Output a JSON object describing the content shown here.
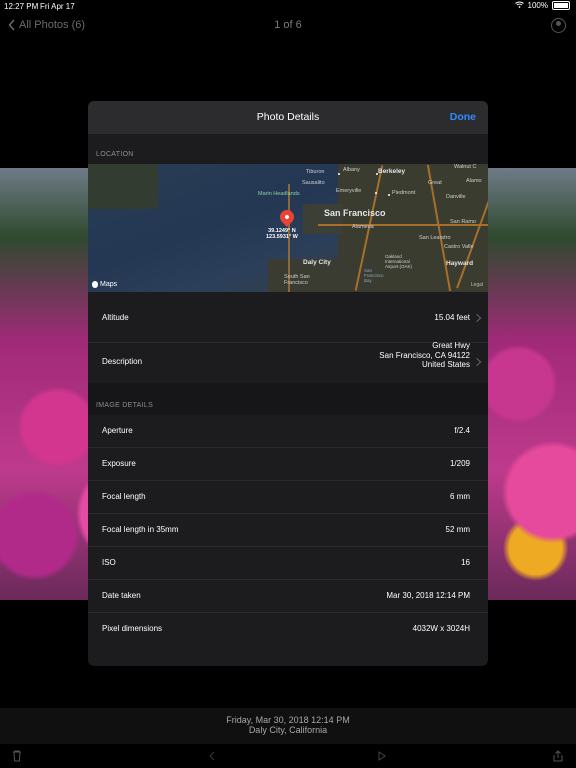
{
  "status_bar": {
    "time": "12:27 PM",
    "date": "Fri Apr 17",
    "battery": "100%"
  },
  "nav": {
    "back_label": "All Photos (6)",
    "title": "1 of 6"
  },
  "modal": {
    "title": "Photo Details",
    "done_label": "Done",
    "location_header": "LOCATION",
    "image_details_header": "IMAGE DETAILS"
  },
  "map": {
    "maps_brand": "Maps",
    "legal": "Legal",
    "coord_lat": "39.1249° N",
    "coord_lon": "123.5931° W",
    "labels": {
      "tiburon": "Tiburon",
      "albany": "Albany",
      "berkeley": "Berkeley",
      "walnut": "Walnut C",
      "sausalito": "Sausalito",
      "emeryville": "Emeryville",
      "piedmont": "Piedmont",
      "great": "Great",
      "alamo": "Alamo",
      "marin": "Marin Headlands",
      "danville": "Danville",
      "sf": "San Francisco",
      "alameda": "Alameda",
      "sanramon": "San Ramo",
      "sanleandro": "San Leandro",
      "castro": "Castro Valle",
      "oakland": "Oakland International Airport (OAK)",
      "daly": "Daly City",
      "hayward": "Hayward",
      "sfbay": "San Francisco Bay",
      "southsf": "South San Francisco"
    }
  },
  "location_rows": [
    {
      "key": "Altitude",
      "value": "15.04 feet"
    },
    {
      "key": "Description",
      "value_lines": [
        "Great Hwy",
        "San Francisco, CA 94122",
        "United States"
      ]
    }
  ],
  "image_details": [
    {
      "key": "Aperture",
      "value": "f/2.4"
    },
    {
      "key": "Exposure",
      "value": "1/209"
    },
    {
      "key": "Focal length",
      "value": "6 mm"
    },
    {
      "key": "Focal length in 35mm",
      "value": "52 mm"
    },
    {
      "key": "ISO",
      "value": "16"
    },
    {
      "key": "Date taken",
      "value": "Mar 30, 2018 12:14 PM"
    },
    {
      "key": "Pixel dimensions",
      "value": "4032W x 3024H"
    }
  ],
  "bottom_info": {
    "date": "Friday, Mar 30, 2018 12:14 PM",
    "place": "Daly City, California"
  },
  "colors": {
    "accent": "#2f8cff",
    "modal_bg": "#1c1c1e",
    "header_bg": "#2c2c2e"
  }
}
